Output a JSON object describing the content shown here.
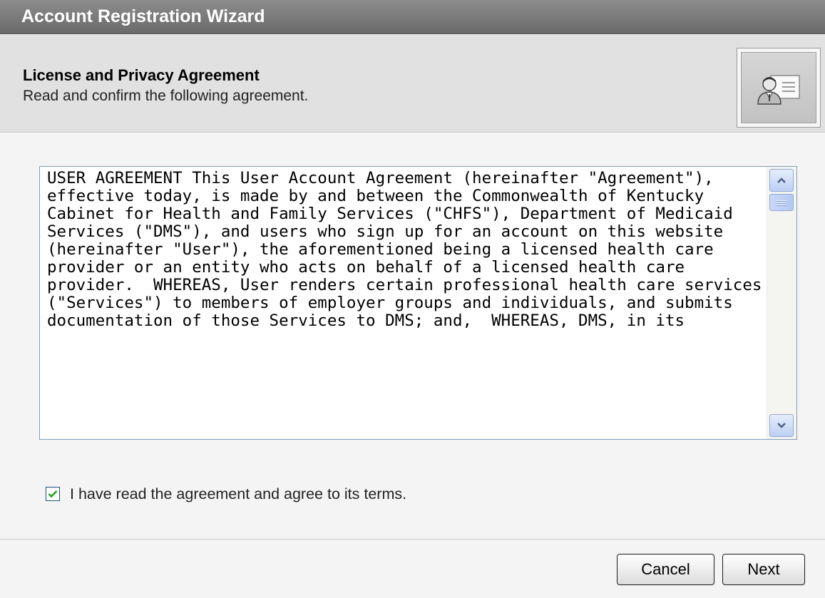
{
  "window": {
    "title": "Account Registration Wizard"
  },
  "header": {
    "title": "License and Privacy Agreement",
    "subtitle": "Read and confirm the following agreement.",
    "icon": "user-card-icon"
  },
  "agreement": {
    "text": "USER AGREEMENT This User Account Agreement (hereinafter \"Agreement\"), effective today, is made by and between the Commonwealth of Kentucky Cabinet for Health and Family Services (\"CHFS\"), Department of Medicaid Services (\"DMS\"), and users who sign up for an account on this website (hereinafter \"User\"), the aforementioned being a licensed health care provider or an entity who acts on behalf of a licensed health care provider.  WHEREAS, User renders certain professional health care services (\"Services\") to members of employer groups and individuals, and submits documentation of those Services to DMS; and,  WHEREAS, DMS, in its"
  },
  "consent": {
    "label": "I have read the agreement and agree to its terms.",
    "checked": true
  },
  "buttons": {
    "cancel": "Cancel",
    "next": "Next"
  },
  "colors": {
    "titlebar": "#7a7a7a",
    "header_bg": "#e1e1e1",
    "scroll_accent": "#bcd0f4"
  }
}
